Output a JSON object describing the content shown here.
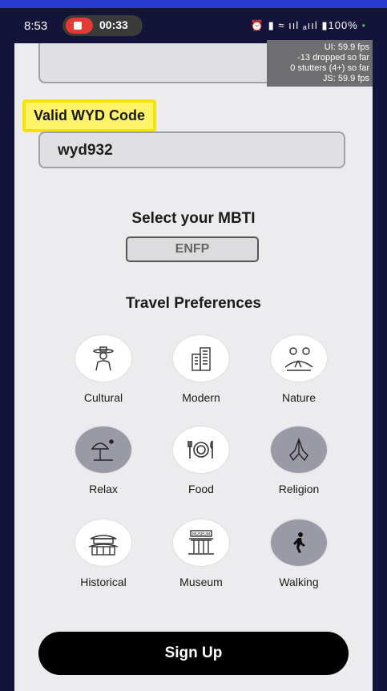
{
  "status_bar": {
    "time": "8:53",
    "record_time": "00:33",
    "system_icons": "⏰ ▮ ≈ ııl ₐııl ▮100%",
    "battery_dot": "•"
  },
  "perf_overlay": {
    "line1": "UI: 59.9 fps",
    "line2": "-13 dropped so far",
    "line3": "0 stutters (4+) so far",
    "line4": "JS: 59.9 fps"
  },
  "form": {
    "wyd_label": "Valid WYD Code",
    "wyd_value": "wyd932",
    "mbti_title": "Select your MBTI",
    "mbti_value": "ENFP",
    "pref_title": "Travel Preferences"
  },
  "preferences": [
    {
      "label": "Cultural",
      "icon": "person-hat-icon",
      "selected": false
    },
    {
      "label": "Modern",
      "icon": "buildings-icon",
      "selected": false
    },
    {
      "label": "Nature",
      "icon": "mountain-tree-icon",
      "selected": false
    },
    {
      "label": "Relax",
      "icon": "beach-umbrella-icon",
      "selected": true
    },
    {
      "label": "Food",
      "icon": "plate-cutlery-icon",
      "selected": false
    },
    {
      "label": "Religion",
      "icon": "praying-hands-icon",
      "selected": true
    },
    {
      "label": "Historical",
      "icon": "palace-icon",
      "selected": false
    },
    {
      "label": "Museum",
      "icon": "museum-icon",
      "selected": false
    },
    {
      "label": "Walking",
      "icon": "walking-person-icon",
      "selected": true
    }
  ],
  "signup_label": "Sign Up",
  "colors": {
    "highlight": "#fff36a",
    "selected_circle": "#9a9aa6",
    "button": "#000000",
    "frame": "#14143a"
  }
}
